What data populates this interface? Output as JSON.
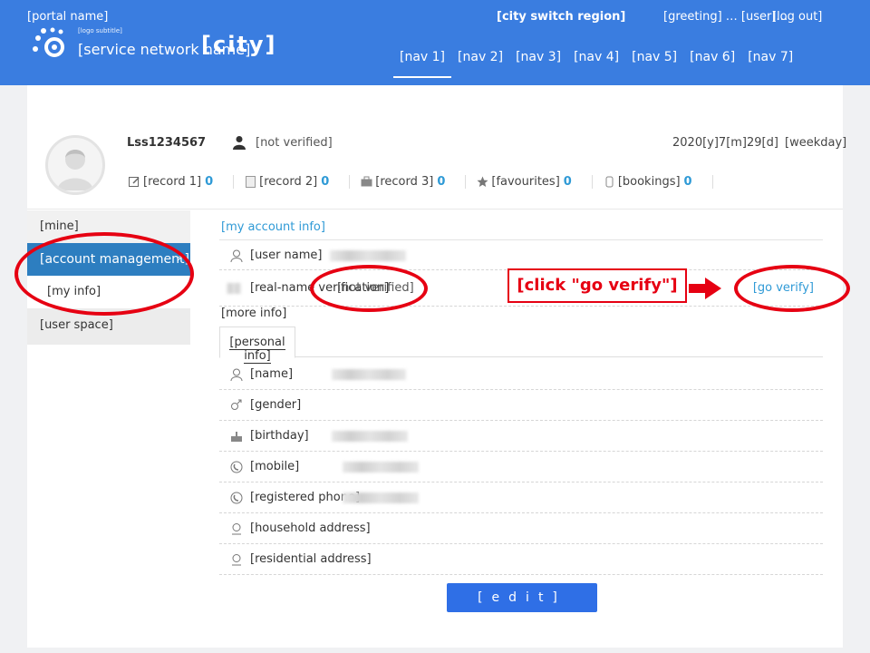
{
  "header": {
    "portal_link": "[portal name]",
    "logo_subtitle": "[logo subtitle]",
    "logo_name": "[service network name]",
    "logo_city": "[city]",
    "region_switch": "[city switch region]",
    "greeting": "[greeting] … [user]…",
    "logout": "[log out]",
    "nav": [
      "[nav 1]",
      "[nav 2]",
      "[nav 3]",
      "[nav 4]",
      "[nav 5]",
      "[nav 6]",
      "[nav 7]"
    ],
    "active_nav": 0,
    "brand_color": "#3a7de0"
  },
  "profile": {
    "username": "Lss1234567",
    "realname_status": "[not verified]",
    "date": "2020[y]7[m]29[d]",
    "weekday": "[weekday]"
  },
  "stats": [
    {
      "label": "[record 1]",
      "count": "0",
      "icon": "edit-icon"
    },
    {
      "label": "[record 2]",
      "count": "0",
      "icon": "document-icon"
    },
    {
      "label": "[record 3]",
      "count": "0",
      "icon": "briefcase-icon"
    },
    {
      "label": "[favourites]",
      "count": "0",
      "icon": "star-icon"
    },
    {
      "label": "[bookings]",
      "count": "0",
      "icon": "calendar-icon"
    }
  ],
  "sidebar": {
    "heading": "[mine]",
    "items": [
      {
        "label": "[account management]"
      },
      {
        "label": "[my info]"
      },
      {
        "label": "[user space]"
      }
    ],
    "active_color": "#2d7ec0"
  },
  "account": {
    "section_title": "[my account info]",
    "rows": [
      {
        "label": "[user name]"
      },
      {
        "label": "[real-name verification]",
        "value": "[not verified]",
        "action": "[go verify]"
      }
    ],
    "more_title": "[more info]",
    "tab": "[personal info]",
    "fields": [
      {
        "label": "[name]"
      },
      {
        "label": "[gender]"
      },
      {
        "label": "[birthday]"
      },
      {
        "label": "[mobile]"
      },
      {
        "label": "[registered phone]"
      },
      {
        "label": "[household address]"
      },
      {
        "label": "[residential address]"
      }
    ],
    "submit": "[edit]",
    "link_color": "#2f9ad6"
  },
  "annotation": {
    "callout": "[click \"go verify\"]",
    "color": "#e60012"
  }
}
